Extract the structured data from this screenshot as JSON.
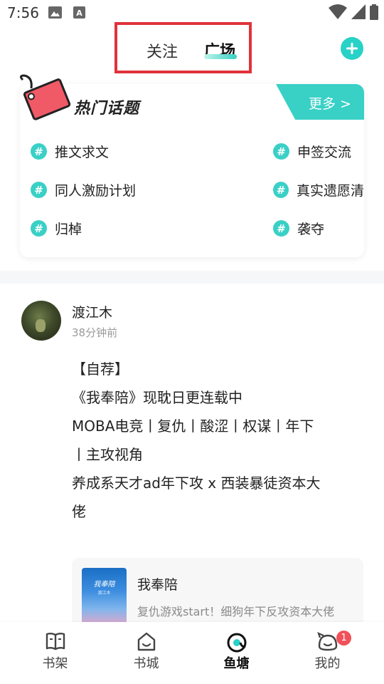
{
  "status_bar": {
    "time": "7:56",
    "left_icons": [
      "image-icon",
      "text-a-icon"
    ],
    "right_icons": [
      "wifi-icon",
      "signal-icon",
      "battery-icon"
    ]
  },
  "header": {
    "tabs": [
      {
        "label": "关注",
        "active": false
      },
      {
        "label": "广场",
        "active": true
      }
    ],
    "add_icon": "plus-icon",
    "accent_color": "#28d2c7",
    "highlight_color": "#e0323a"
  },
  "hot_topics": {
    "title": "热门话题",
    "more_label": "更多 >",
    "hash_symbol": "#",
    "topics_left": [
      "推文求文",
      "同人激励计划",
      "归棹"
    ],
    "topics_right": [
      "申签交流",
      "真实遗愿清",
      "袭夺"
    ]
  },
  "post": {
    "author": "渡江木",
    "time": "38分钟前",
    "lines": [
      "【自荐】",
      "《我奉陪》现耽日更连载中",
      "MOBA电竞丨复仇丨酸涩丨权谋丨年下",
      "丨主攻视角",
      "养成系天才ad年下攻 x 西装暴徒资本大",
      "佬"
    ],
    "book": {
      "cover_title": "我奉陪",
      "cover_sub": "渡江木",
      "title": "我奉陪",
      "description": "复仇游戏start！细狗年下反攻资本大佬"
    }
  },
  "bottom_nav": {
    "items": [
      {
        "label": "书架",
        "icon": "bookshelf-icon",
        "active": false
      },
      {
        "label": "书城",
        "icon": "bookstore-icon",
        "active": false
      },
      {
        "label": "鱼塘",
        "icon": "fishpond-icon",
        "active": true
      },
      {
        "label": "我的",
        "icon": "profile-icon",
        "active": false
      }
    ],
    "badge_count": "1"
  }
}
